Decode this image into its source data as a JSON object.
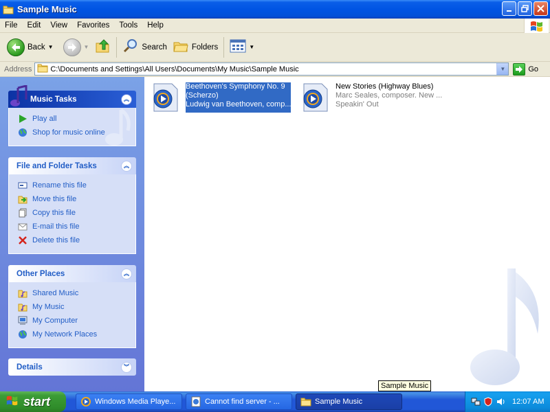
{
  "window": {
    "title": "Sample Music"
  },
  "menu": {
    "items": [
      "File",
      "Edit",
      "View",
      "Favorites",
      "Tools",
      "Help"
    ]
  },
  "toolbar": {
    "back_label": "Back",
    "search_label": "Search",
    "folders_label": "Folders"
  },
  "address": {
    "label": "Address",
    "value": "C:\\Documents and Settings\\All Users\\Documents\\My Music\\Sample Music",
    "go_label": "Go"
  },
  "taskpane": {
    "music_tasks": {
      "title": "Music Tasks",
      "items": [
        "Play all",
        "Shop for music online"
      ]
    },
    "file_folder_tasks": {
      "title": "File and Folder Tasks",
      "items": [
        "Rename this file",
        "Move this file",
        "Copy this file",
        "E-mail this file",
        "Delete this file"
      ]
    },
    "other_places": {
      "title": "Other Places",
      "items": [
        "Shared Music",
        "My Music",
        "My Computer",
        "My Network Places"
      ]
    },
    "details": {
      "title": "Details"
    }
  },
  "files": [
    {
      "title_line1": "Beethoven's Symphony No. 9",
      "title_line2": "(Scherzo)",
      "meta_line1": "Ludwig van Beethoven, comp...",
      "meta_line2": "",
      "selected": true
    },
    {
      "title_line1": "New Stories (Highway Blues)",
      "title_line2": "",
      "meta_line1": "Marc Seales, composer. New ...",
      "meta_line2": "Speakin' Out",
      "selected": false
    }
  ],
  "tooltip": "Sample Music",
  "taskbar": {
    "start_label": "start",
    "buttons": [
      {
        "label": "Windows Media Playe..."
      },
      {
        "label": "Cannot find server - ..."
      },
      {
        "label": "Sample Music"
      }
    ],
    "clock": "12:07 AM"
  },
  "colors": {
    "title_blue": "#0054e3",
    "task_link": "#215dc6",
    "selection": "#316ac5",
    "start_green": "#3c9c36"
  }
}
